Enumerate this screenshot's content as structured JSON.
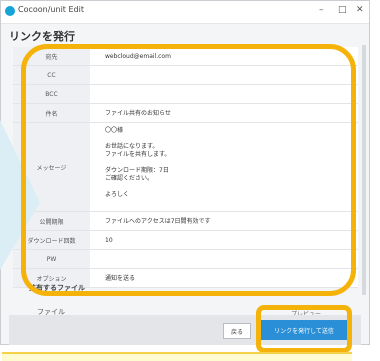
{
  "window": {
    "app_title": "Cocoon/unit Edit",
    "controls": [
      "–",
      "□",
      "✕"
    ]
  },
  "heading": "リンクを発行",
  "rows": [
    {
      "label": "宛先",
      "value": "webcloud@email.com"
    },
    {
      "label": "CC",
      "value": ""
    },
    {
      "label": "BCC",
      "value": ""
    },
    {
      "label": "件名",
      "value": "ファイル共有のお知らせ"
    },
    {
      "label": "メッセージ",
      "lines": [
        "〇〇様",
        "",
        "お世話になります。",
        "ファイルを共有します。",
        "",
        "ダウンロード期限：7日",
        "ご確認ください。",
        "",
        "よろしく"
      ]
    },
    {
      "label": "公開期限",
      "value": "ファイルへのアクセスは7日間有効です"
    },
    {
      "label": "ダウンロード回数",
      "value": "10"
    },
    {
      "label": "PW",
      "value": ""
    },
    {
      "label": "オプション",
      "value": "通知を送る"
    }
  ],
  "section": {
    "title": "共有するファイル",
    "file_label": "ファイル",
    "right_label": "プレビュー"
  },
  "buttons": {
    "back": "戻る",
    "issue": "リンクを発行して送信"
  }
}
